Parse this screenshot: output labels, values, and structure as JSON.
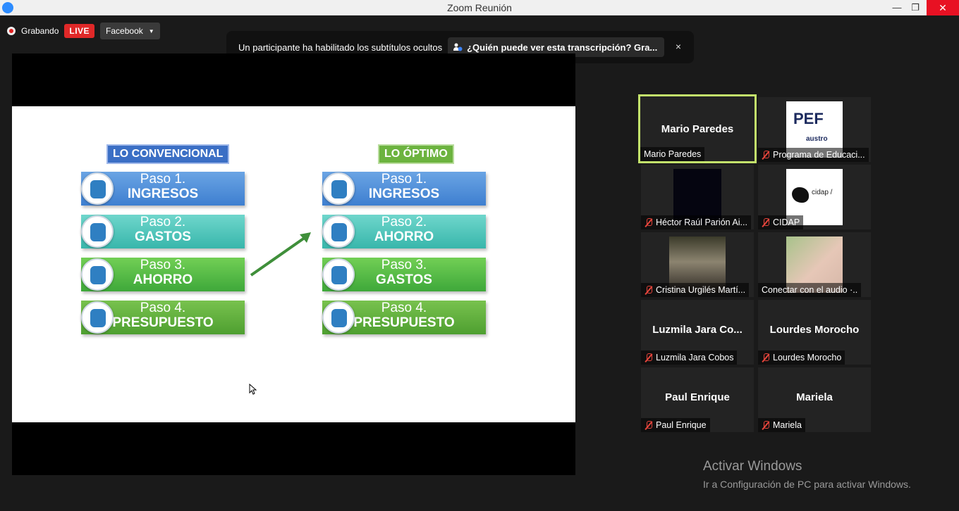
{
  "window": {
    "title": "Zoom Reunión",
    "minimize": "—",
    "restore": "❐",
    "close": "✕"
  },
  "recording": {
    "status": "Grabando",
    "live": "LIVE",
    "platform": "Facebook"
  },
  "captions_banner": {
    "message": "Un participante ha habilitado los subtítulos ocultos",
    "who_can_see": "¿Quién puede ver esta transcripción? Gra...",
    "close": "×"
  },
  "slide": {
    "left_header": "LO CONVENCIONAL",
    "right_header": "LO ÓPTIMO",
    "left_steps": [
      {
        "paso": "Paso 1.",
        "name": "INGRESOS"
      },
      {
        "paso": "Paso 2.",
        "name": "GASTOS"
      },
      {
        "paso": "Paso 3.",
        "name": "AHORRO"
      },
      {
        "paso": "Paso 4.",
        "name": "PRESUPUESTO"
      }
    ],
    "right_steps": [
      {
        "paso": "Paso 1.",
        "name": "INGRESOS"
      },
      {
        "paso": "Paso 2.",
        "name": "AHORRO"
      },
      {
        "paso": "Paso 3.",
        "name": "GASTOS"
      },
      {
        "paso": "Paso 4.",
        "name": "PRESUPUESTO"
      }
    ]
  },
  "participants": [
    {
      "big_name": "Mario Paredes",
      "label": "Mario Paredes",
      "muted": false
    },
    {
      "label": "Programa de Educaci...",
      "muted": true,
      "logo_title": "PEF",
      "logo_sub": "austro"
    },
    {
      "label": "Héctor Raúl Parión Ai...",
      "muted": true
    },
    {
      "label": "CIDAP",
      "muted": true,
      "logo_title": "cidap /"
    },
    {
      "label": "Cristina Urgilés Martí...",
      "muted": true
    },
    {
      "label": "Conectar con el audio ·..",
      "muted": false
    },
    {
      "big_name": "Luzmila Jara Co...",
      "label": "Luzmila Jara Cobos",
      "muted": true
    },
    {
      "big_name": "Lourdes Morocho",
      "label": "Lourdes Morocho",
      "muted": true
    },
    {
      "big_name": "Paul Enrique",
      "label": "Paul Enrique",
      "muted": true
    },
    {
      "big_name": "Mariela",
      "label": "Mariela",
      "muted": true
    }
  ],
  "windows_activation": {
    "title": "Activar Windows",
    "subtitle": "Ir a Configuración de PC para activar Windows."
  }
}
